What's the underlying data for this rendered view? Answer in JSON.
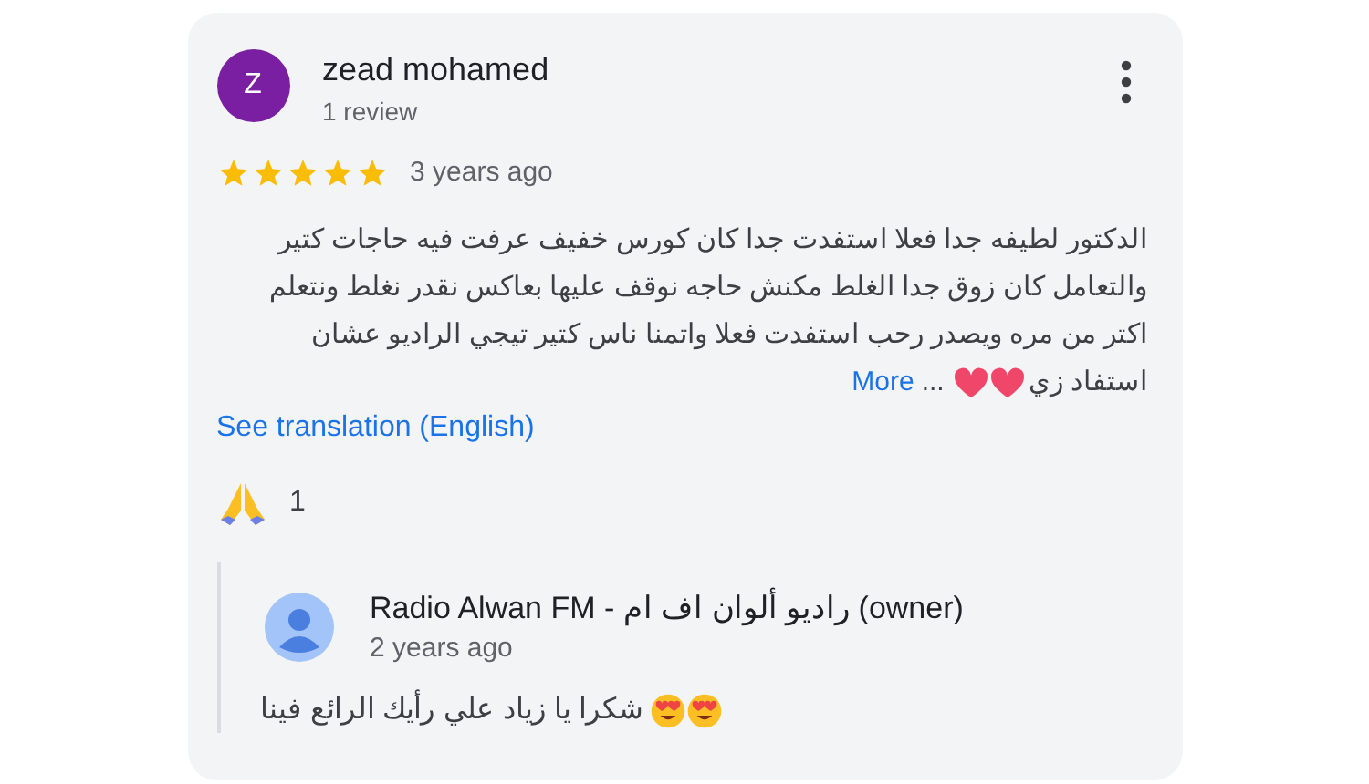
{
  "review": {
    "avatar_letter": "Z",
    "author": "zead mohamed",
    "meta": "1 review",
    "stars": 5,
    "time": "3 years ago",
    "text_lines": [
      "الدكتور لطيفه جدا فعلا استفدت جدا كان كورس خفيف عرفت فيه حاجات كتير",
      "والتعامل كان زوق جدا الغلط مكنش حاجه نوقف عليها بعاكس نقدر نغلط ونتعلم",
      "اكتر من مره ويصدر رحب استفدت فعلا واتمنا ناس كتير تيجي الراديو عشان"
    ],
    "text_end": "استفاد زي",
    "ellipsis": "...",
    "more": "More",
    "translation": "See translation (English)",
    "reaction_count": "1"
  },
  "reply": {
    "author": "Radio Alwan FM - راديو ألوان اف ام (owner)",
    "time": "2 years ago",
    "text": "شكرا يا زياد علي رأيك الرائع فينا"
  }
}
